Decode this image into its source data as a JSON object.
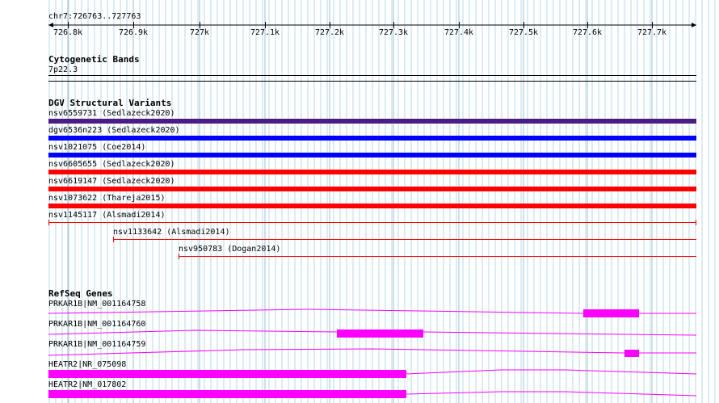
{
  "ruler": {
    "region": "chr7:726763..727763",
    "ticks": [
      "726.8k",
      "726.9k",
      "727k",
      "727.1k",
      "727.2k",
      "727.3k",
      "727.4k",
      "727.5k",
      "727.6k",
      "727.7k"
    ]
  },
  "cytoband": {
    "title": "Cytogenetic Bands",
    "band": "7p22.3"
  },
  "dgv": {
    "title": "DGV Structural Variants",
    "variants": [
      {
        "label": "nsv6559731 (Sedlazeck2020)",
        "color": "#4b1c82"
      },
      {
        "label": "dgv6536n223 (Sedlazeck2020)",
        "color": "#0000ff"
      },
      {
        "label": "nsv1021075 (Coe2014)",
        "color": "#0000ff"
      },
      {
        "label": "nsv6605655 (Sedlazeck2020)",
        "color": "#ff0000"
      },
      {
        "label": "nsv6619147 (Sedlazeck2020)",
        "color": "#ff0000"
      },
      {
        "label": "nsv1073622 (Thareja2015)",
        "color": "#ff0000"
      },
      {
        "label": "nsv1145117 (Alsmadi2014)",
        "color": "#ff0000"
      },
      {
        "label": "nsv1133642 (Alsmadi2014)",
        "color": "#ff0000"
      },
      {
        "label": "nsv950783 (Dogan2014)",
        "color": "#ff0000"
      }
    ]
  },
  "refseq": {
    "title": "RefSeq Genes",
    "color": "#ff00ff",
    "genes": [
      {
        "label": "PRKAR1B|NM_001164758"
      },
      {
        "label": "PRKAR1B|NM_001164760"
      },
      {
        "label": "PRKAR1B|NM_001164759"
      },
      {
        "label": "HEATR2|NR_075098"
      },
      {
        "label": "HEATR2|NM_017802"
      }
    ]
  },
  "colors": {
    "grid": "#b8d8e8",
    "gridMajor": "#98c0d8",
    "divider": "#000000"
  }
}
